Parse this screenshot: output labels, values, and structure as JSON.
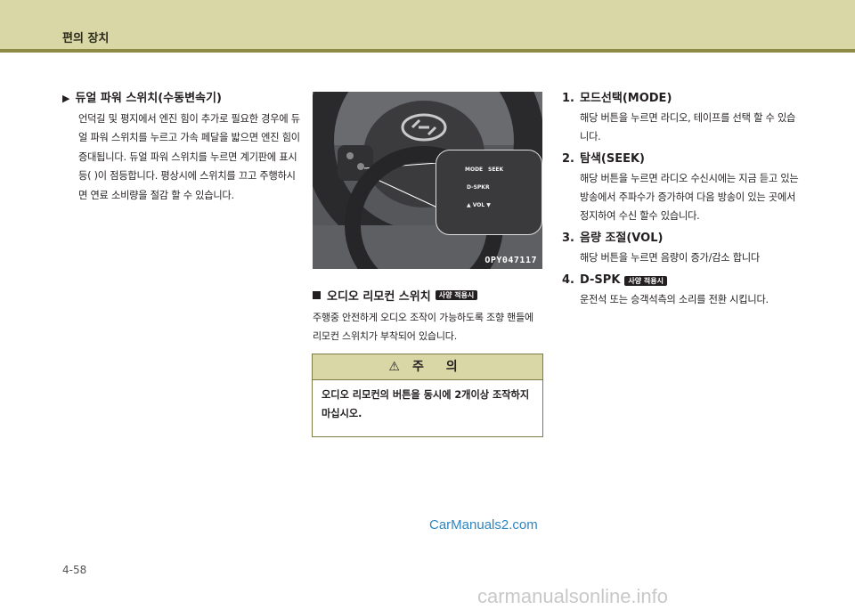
{
  "header": {
    "title": "편의 장치"
  },
  "section_left": {
    "title": "듀얼 파워 스위치(수동변속기)",
    "paragraph": "언덕길 및 평지에서 엔진 힘이 추가로 필요한 경우에 듀얼 파워 스위치를 누르고 가속 페달을 밟으면 엔진 힘이 증대됩니다. 듀얼 파워 스위치를 누르면 계기판에 표시등(   )이 점등합니다. 평상시에 스위치를 끄고 주행하시면 연료 소비량을 절감 할 수 있습니다."
  },
  "photo": {
    "code": "OPY047117",
    "inset_labels": {
      "mode": "MODE",
      "seek": "SEEK",
      "dspk": "D-SPKR",
      "vol": "▲ VOL ▼"
    }
  },
  "remote": {
    "title": "오디오 리모컨 스위치",
    "badge": "사양 적용시",
    "paragraph": "주행중 안전하게 오디오 조작이 가능하도록 조향 핸들에 리모컨 스위치가 부착되어 있습니다."
  },
  "caution": {
    "heading": "주 의",
    "text": "오디오 리모컨의 버튼을 동시에 2개이상 조작하지 마십시오."
  },
  "items": [
    {
      "num": "1.",
      "title": "모드선택(MODE)",
      "text": "해당 버튼을 누르면 라디오, 테이프를 선택 할 수 있습니다."
    },
    {
      "num": "2.",
      "title": "탐색(SEEK)",
      "text": "해당 버튼을 누르면 라디오 수신시에는 지금 듣고 있는 방송에서 주파수가 증가하여 다음 방송이 있는 곳에서 정지하여 수신 할수 있습니다."
    },
    {
      "num": "3.",
      "title": "음량 조절(VOL)",
      "text": "해당 버튼을 누르면 음량이 증가/감소 합니다"
    },
    {
      "num": "4.",
      "title": "D-SPK",
      "badge": "사양 적용시",
      "text": "운전석 또는 승객석측의 소리를 전환 시킵니다."
    }
  ],
  "footer": {
    "page": "4-58",
    "watermark": "CarManuals2.com",
    "site": "carmanualsonline.info"
  }
}
